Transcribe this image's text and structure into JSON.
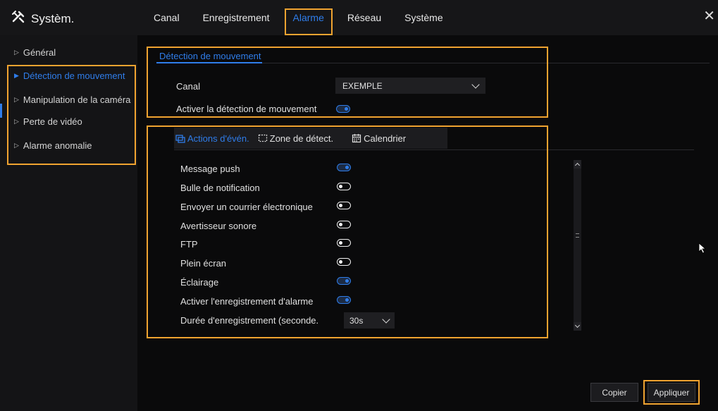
{
  "app": {
    "title": "Systèm."
  },
  "top_nav": [
    {
      "label": "Canal"
    },
    {
      "label": "Enregistrement"
    },
    {
      "label": "Alarme",
      "active": true
    },
    {
      "label": "Réseau"
    },
    {
      "label": "Système"
    }
  ],
  "sidebar": {
    "items": [
      {
        "label": "Général"
      },
      {
        "label": "Détection de mouvement",
        "active": true
      },
      {
        "label": "Manipulation de la caméra"
      },
      {
        "label": "Perte de vidéo"
      },
      {
        "label": "Alarme anomalie"
      }
    ]
  },
  "section_tab": "Détection de mouvement",
  "settings": {
    "canal_label": "Canal",
    "canal_value": "EXEMPLE",
    "enable_label": "Activer la détection de mouvement",
    "enable_on": true
  },
  "event_tabs": [
    {
      "label": "Actions d'évén.",
      "icon": "actions-icon",
      "active": true
    },
    {
      "label": "Zone de détect.",
      "icon": "zone-icon"
    },
    {
      "label": "Calendrier",
      "icon": "calendar-icon"
    }
  ],
  "actions": [
    {
      "label": "Message push",
      "on": true
    },
    {
      "label": "Bulle de notification",
      "on": false
    },
    {
      "label": "Envoyer un courrier électronique",
      "on": false
    },
    {
      "label": "Avertisseur sonore",
      "on": false
    },
    {
      "label": "FTP",
      "on": false
    },
    {
      "label": "Plein écran",
      "on": false
    },
    {
      "label": "Éclairage",
      "on": true
    },
    {
      "label": "Activer l'enregistrement d'alarme",
      "on": true
    }
  ],
  "duration": {
    "label": "Durée d'enregistrement (seconde.",
    "value": "30s"
  },
  "buttons": {
    "copy": "Copier",
    "apply": "Appliquer"
  },
  "colors": {
    "accent": "#2f7dea",
    "highlight": "#f0a330"
  }
}
